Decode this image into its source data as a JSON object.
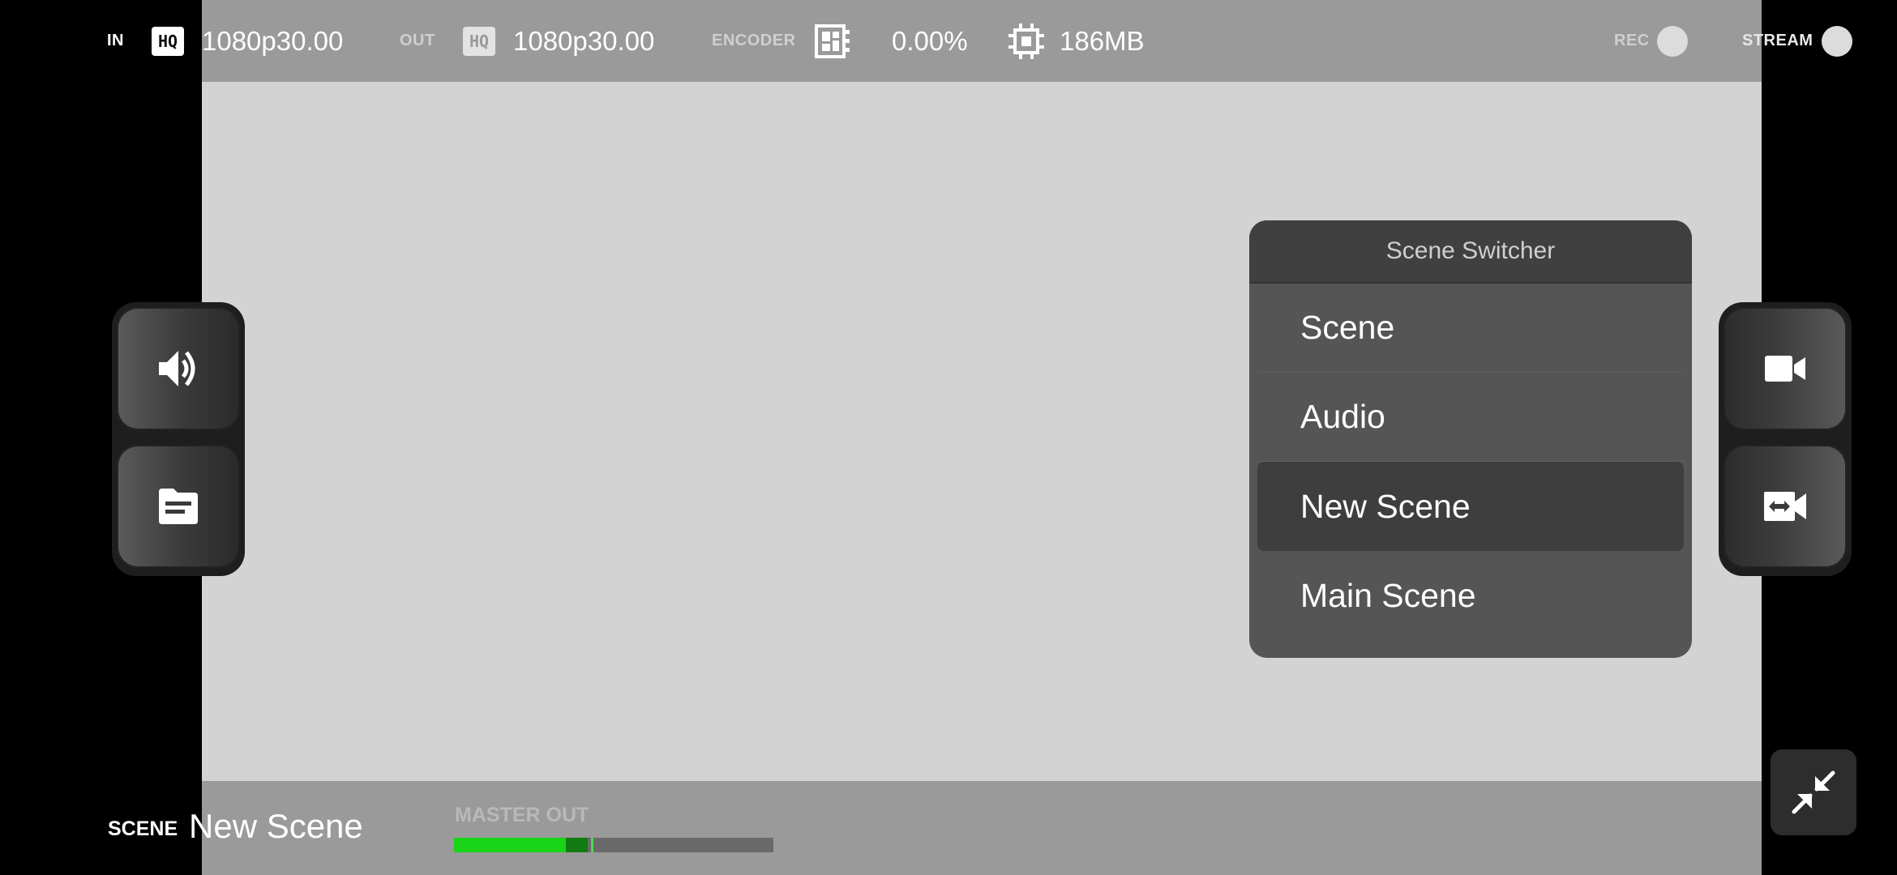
{
  "topbar": {
    "in_label": "IN",
    "in_quality_badge": "HQ",
    "in_format": "1080p30.00",
    "out_label": "OUT",
    "out_quality_badge": "HQ",
    "out_format": "1080p30.00",
    "encoder_label": "ENCODER",
    "encoder_load": "0.00%",
    "memory": "186MB",
    "rec_label": "REC",
    "stream_label": "STREAM"
  },
  "left_controls": {
    "icons": [
      "volume-icon",
      "notes-icon"
    ]
  },
  "right_controls": {
    "icons": [
      "camera-icon",
      "camera-switch-icon"
    ]
  },
  "scene_switcher": {
    "title": "Scene Switcher",
    "items": [
      "Scene",
      "Audio",
      "New Scene",
      "Main Scene"
    ],
    "selected": "New Scene"
  },
  "bottombar": {
    "scene_label": "SCENE",
    "scene_name": "New Scene",
    "master_label": "MASTER OUT",
    "master_level": 0.35,
    "master_peak": 0.42
  },
  "colors": {
    "meter_green": "#19d419",
    "panel_bg": "#555555",
    "bar_bg": "#9a9a9a"
  }
}
